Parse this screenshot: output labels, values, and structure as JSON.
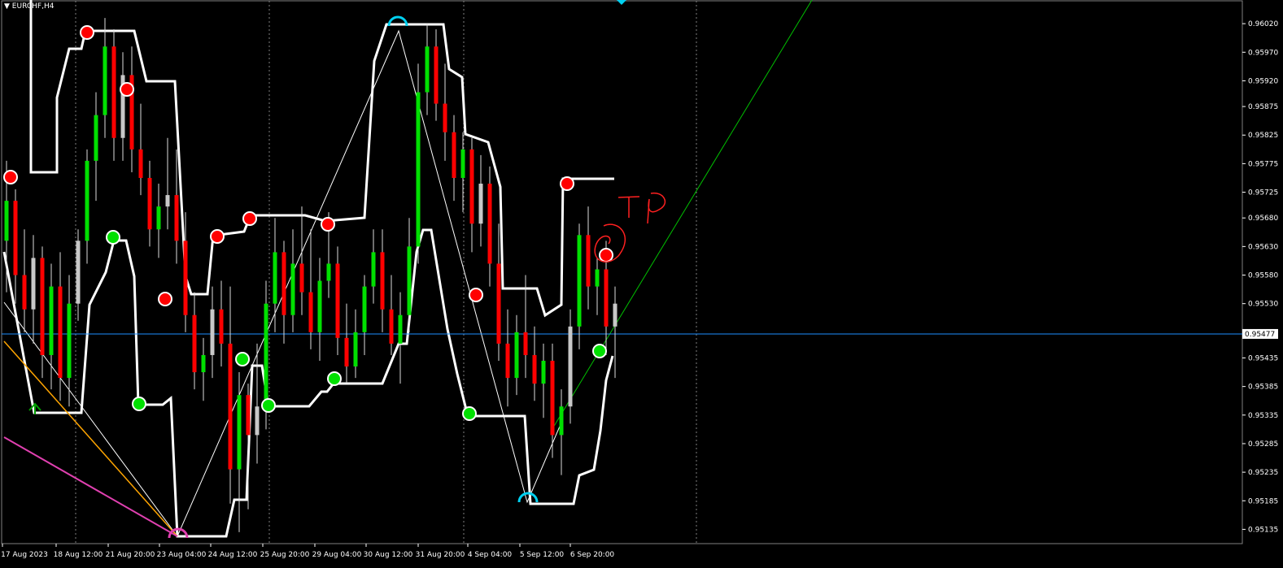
{
  "window": {
    "symbol_label": "EURCHF,H4"
  },
  "colors": {
    "background": "#000000",
    "bull": "#00e000",
    "bull_alt": "#c8c8c8",
    "bear": "#ff0000",
    "channel": "#ffffff",
    "bid_line": "#1e90ff",
    "trend_green": "#00c000",
    "trend_orange": "#ffa500",
    "trend_magenta": "#e040b0",
    "grid": "#808080"
  },
  "chart_data": {
    "type": "candlestick",
    "symbol": "EURCHF",
    "timeframe": "H4",
    "ylim": [
      0.9511,
      0.9606
    ],
    "y_ticks": [
      "0.96020",
      "0.95970",
      "0.95920",
      "0.95875",
      "0.95825",
      "0.95775",
      "0.95725",
      "0.95680",
      "0.95630",
      "0.95580",
      "0.95530",
      "0.95435",
      "0.95385",
      "0.95335",
      "0.95285",
      "0.95235",
      "0.95185",
      "0.95135"
    ],
    "x_labels": [
      "17 Aug 2023",
      "18 Aug 12:00",
      "21 Aug 20:00",
      "23 Aug 04:00",
      "24 Aug 12:00",
      "25 Aug 20:00",
      "29 Aug 04:00",
      "30 Aug 12:00",
      "31 Aug 20:00",
      "4 Sep 04:00",
      "5 Sep 12:00",
      "6 Sep 20:00"
    ],
    "current_price": "0.95477",
    "candles": [
      [
        0.9564,
        0.9578,
        0.9555,
        0.9571
      ],
      [
        0.9571,
        0.9573,
        0.9553,
        0.9558
      ],
      [
        0.9558,
        0.9566,
        0.9548,
        0.9552
      ],
      [
        0.9552,
        0.9565,
        0.9546,
        0.9561
      ],
      [
        0.9561,
        0.9563,
        0.954,
        0.9544
      ],
      [
        0.9544,
        0.956,
        0.9538,
        0.9556
      ],
      [
        0.9556,
        0.9562,
        0.9536,
        0.954
      ],
      [
        0.954,
        0.9558,
        0.9535,
        0.9553
      ],
      [
        0.9553,
        0.9566,
        0.955,
        0.9564
      ],
      [
        0.9564,
        0.958,
        0.956,
        0.9578
      ],
      [
        0.9578,
        0.959,
        0.9571,
        0.9586
      ],
      [
        0.9586,
        0.9603,
        0.9582,
        0.9598
      ],
      [
        0.9598,
        0.9601,
        0.9578,
        0.9582
      ],
      [
        0.9582,
        0.9597,
        0.9578,
        0.9593
      ],
      [
        0.9593,
        0.9598,
        0.9576,
        0.958
      ],
      [
        0.958,
        0.9588,
        0.9572,
        0.9575
      ],
      [
        0.9575,
        0.9578,
        0.9563,
        0.9566
      ],
      [
        0.9566,
        0.9574,
        0.9561,
        0.957
      ],
      [
        0.957,
        0.9582,
        0.9566,
        0.9572
      ],
      [
        0.9572,
        0.958,
        0.956,
        0.9564
      ],
      [
        0.9564,
        0.9569,
        0.9548,
        0.9551
      ],
      [
        0.9551,
        0.9555,
        0.9538,
        0.9541
      ],
      [
        0.9541,
        0.9547,
        0.9536,
        0.9544
      ],
      [
        0.9544,
        0.9556,
        0.954,
        0.9552
      ],
      [
        0.9552,
        0.9557,
        0.9542,
        0.9546
      ],
      [
        0.9546,
        0.9556,
        0.9518,
        0.9524
      ],
      [
        0.9524,
        0.9541,
        0.9513,
        0.9537
      ],
      [
        0.9537,
        0.9539,
        0.9517,
        0.953
      ],
      [
        0.953,
        0.9546,
        0.9525,
        0.9535
      ],
      [
        0.9535,
        0.9557,
        0.9531,
        0.9553
      ],
      [
        0.9553,
        0.9568,
        0.9548,
        0.9562
      ],
      [
        0.9562,
        0.9564,
        0.9546,
        0.9551
      ],
      [
        0.9551,
        0.9566,
        0.9548,
        0.956
      ],
      [
        0.956,
        0.957,
        0.9551,
        0.9555
      ],
      [
        0.9555,
        0.9566,
        0.9545,
        0.9548
      ],
      [
        0.9548,
        0.9561,
        0.9543,
        0.9557
      ],
      [
        0.9557,
        0.9569,
        0.9554,
        0.956
      ],
      [
        0.956,
        0.9563,
        0.9544,
        0.9547
      ],
      [
        0.9547,
        0.9553,
        0.9539,
        0.9542
      ],
      [
        0.9542,
        0.9552,
        0.954,
        0.9548
      ],
      [
        0.9548,
        0.9558,
        0.9544,
        0.9556
      ],
      [
        0.9556,
        0.9566,
        0.9553,
        0.9562
      ],
      [
        0.9562,
        0.9566,
        0.9548,
        0.9552
      ],
      [
        0.9552,
        0.9558,
        0.9544,
        0.9546
      ],
      [
        0.9546,
        0.9555,
        0.9539,
        0.9551
      ],
      [
        0.9551,
        0.9568,
        0.9548,
        0.9563
      ],
      [
        0.9563,
        0.9595,
        0.956,
        0.959
      ],
      [
        0.959,
        0.9602,
        0.9586,
        0.9598
      ],
      [
        0.9598,
        0.9601,
        0.9585,
        0.9588
      ],
      [
        0.9588,
        0.9595,
        0.9578,
        0.9583
      ],
      [
        0.9583,
        0.9586,
        0.9571,
        0.9575
      ],
      [
        0.9575,
        0.9583,
        0.9569,
        0.958
      ],
      [
        0.958,
        0.9582,
        0.9562,
        0.9567
      ],
      [
        0.9567,
        0.9579,
        0.9563,
        0.9574
      ],
      [
        0.9574,
        0.9577,
        0.9556,
        0.956
      ],
      [
        0.956,
        0.9567,
        0.9543,
        0.9546
      ],
      [
        0.9546,
        0.9552,
        0.9535,
        0.954
      ],
      [
        0.954,
        0.9551,
        0.9537,
        0.9548
      ],
      [
        0.9548,
        0.9558,
        0.954,
        0.9544
      ],
      [
        0.9544,
        0.9549,
        0.9536,
        0.9539
      ],
      [
        0.9539,
        0.9546,
        0.9533,
        0.9543
      ],
      [
        0.9543,
        0.9546,
        0.9526,
        0.953
      ],
      [
        0.953,
        0.9538,
        0.9523,
        0.9535
      ],
      [
        0.9535,
        0.9552,
        0.9532,
        0.9549
      ],
      [
        0.9549,
        0.9567,
        0.9545,
        0.9565
      ],
      [
        0.9565,
        0.957,
        0.9552,
        0.9556
      ],
      [
        0.9556,
        0.9561,
        0.9551,
        0.9559
      ],
      [
        0.9559,
        0.9564,
        0.9544,
        0.9549
      ],
      [
        0.9549,
        0.9556,
        0.954,
        0.9553
      ]
    ]
  }
}
